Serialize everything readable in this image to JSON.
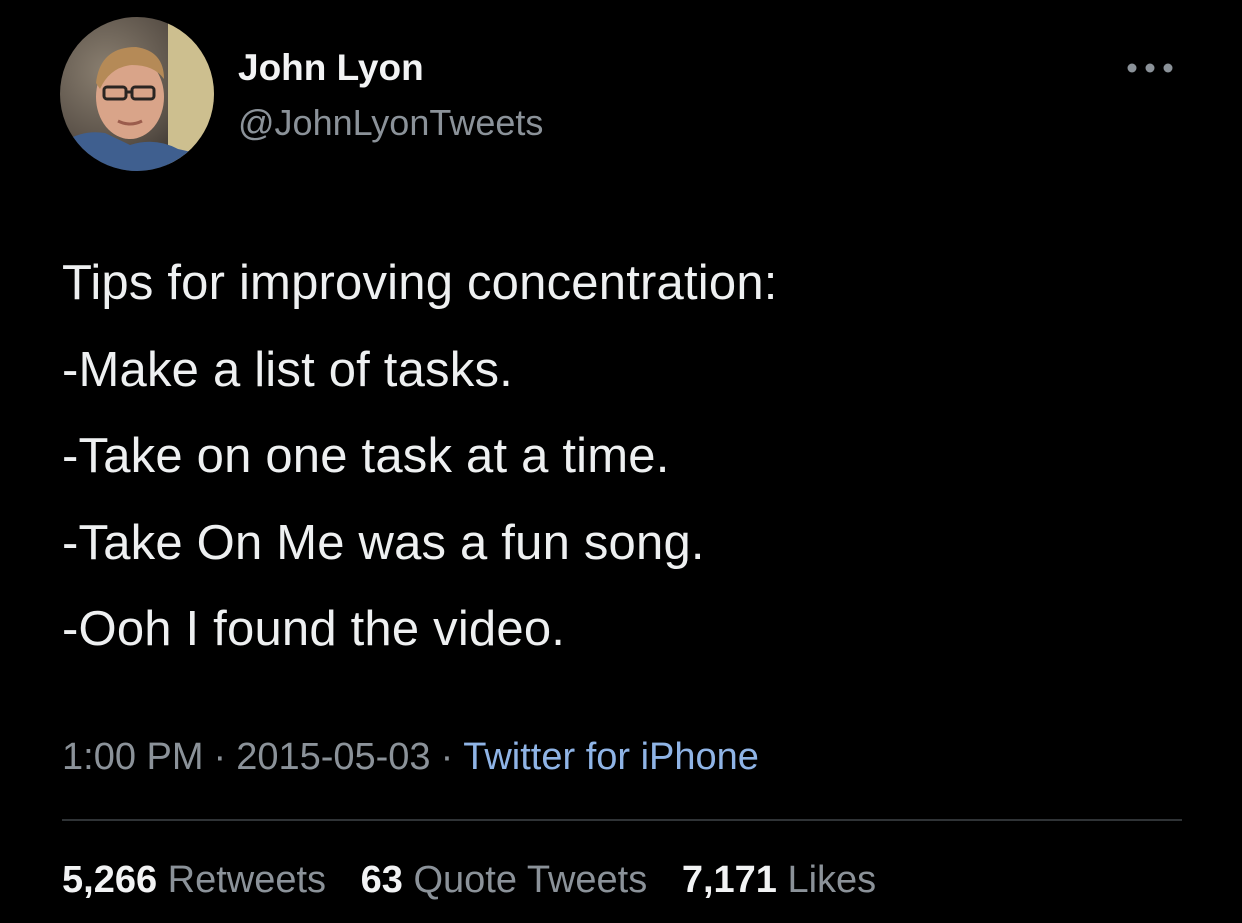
{
  "user": {
    "display_name": "John Lyon",
    "handle": "@JohnLyonTweets"
  },
  "icons": {
    "more": "more-horizontal-icon",
    "avatar": "avatar"
  },
  "tweet": {
    "lines": [
      "Tips for improving concentration:",
      "-Make a list of tasks.",
      "-Take on one task at a time.",
      "-Take On Me was a fun song.",
      "-Ooh I found the video."
    ],
    "time": "1:00 PM",
    "separator": "·",
    "date": "2015-05-03",
    "source": "Twitter for iPhone"
  },
  "stats": {
    "retweets_count": "5,266",
    "retweets_label": "Retweets",
    "quotes_count": "63",
    "quotes_label": "Quote Tweets",
    "likes_count": "7,171",
    "likes_label": "Likes"
  },
  "colors": {
    "background": "#000000",
    "text_primary": "#eef0f1",
    "text_secondary": "#8b9299",
    "link": "#8fb4e6",
    "divider": "#2f3336"
  }
}
